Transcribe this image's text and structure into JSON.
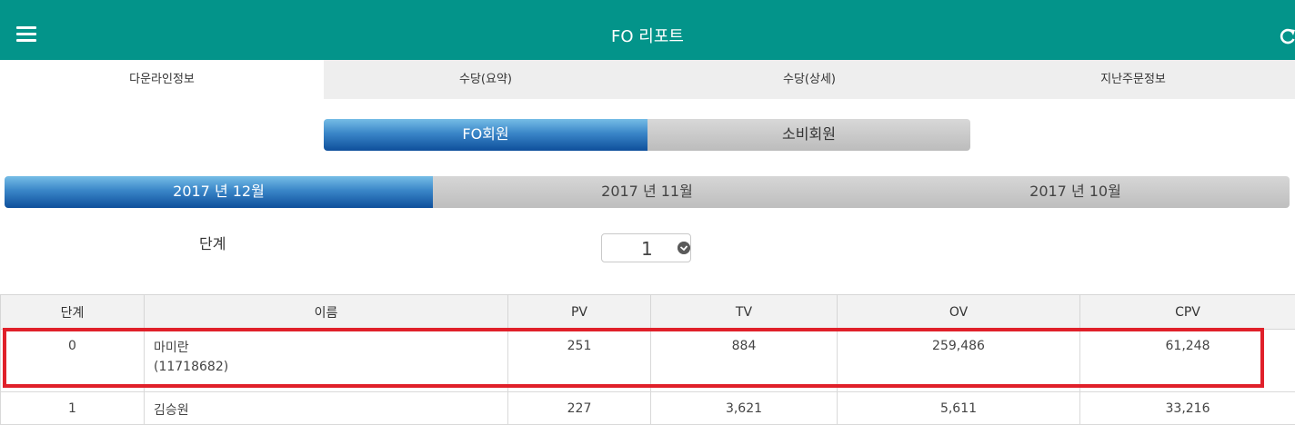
{
  "header": {
    "title": "FO 리포트",
    "menu_icon": "hamburger-menu-icon",
    "refresh_icon": "refresh-icon"
  },
  "tabs": [
    {
      "label": "다운라인정보",
      "active": true
    },
    {
      "label": "수당(요약)",
      "active": false
    },
    {
      "label": "수당(상세)",
      "active": false
    },
    {
      "label": "지난주문정보",
      "active": false
    }
  ],
  "member_type": {
    "fo": "FO회원",
    "consumer": "소비회원",
    "selected": "FO회원"
  },
  "months": [
    {
      "label": "2017 년 12월",
      "selected": true
    },
    {
      "label": "2017 년 11월",
      "selected": false
    },
    {
      "label": "2017 년 10월",
      "selected": false
    }
  ],
  "level": {
    "label": "단계",
    "value": "1"
  },
  "table": {
    "headers": [
      "단계",
      "이름",
      "PV",
      "TV",
      "OV",
      "CPV"
    ],
    "rows": [
      {
        "level": "0",
        "name": "마미란",
        "id": "(11718682)",
        "pv": "251",
        "tv": "884",
        "ov": "259,486",
        "cpv": "61,248"
      },
      {
        "level": "1",
        "name": "김승원",
        "id": "",
        "pv": "227",
        "tv": "3,621",
        "ov": "5,611",
        "cpv": "33,216"
      }
    ]
  },
  "colors": {
    "header_bg": "#03948a",
    "highlight": "#e0202a",
    "active_blue": "#0e4f9b"
  }
}
